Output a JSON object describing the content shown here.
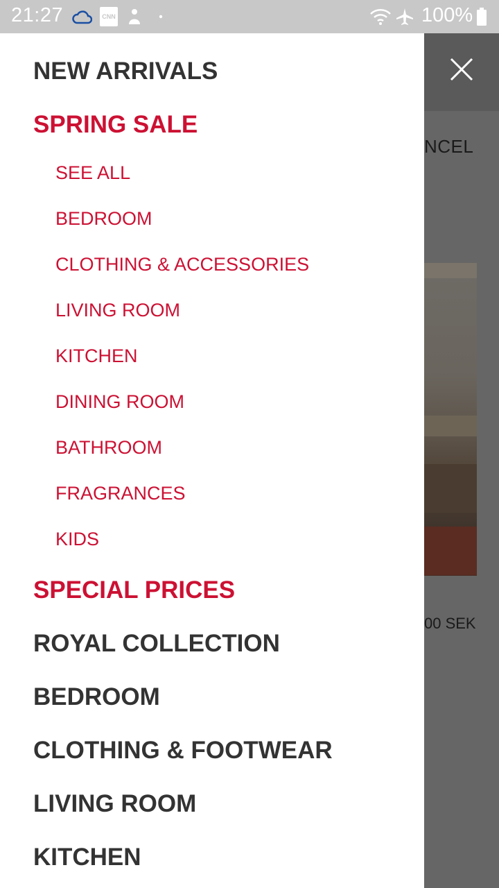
{
  "status_bar": {
    "time": "21:27",
    "battery": "100%",
    "icons": [
      "cloud-icon",
      "cnn-icon",
      "app-icon",
      "dot-icon",
      "wifi-icon",
      "airplane-icon",
      "battery-icon"
    ],
    "cnn_text": "CNN"
  },
  "drawer": {
    "top_items": [
      {
        "label": "NEW ARRIVALS"
      },
      {
        "label": "SPRING SALE"
      }
    ],
    "spring_sale_subitems": [
      {
        "label": "SEE ALL"
      },
      {
        "label": "BEDROOM"
      },
      {
        "label": "CLOTHING & ACCESSORIES"
      },
      {
        "label": "LIVING ROOM"
      },
      {
        "label": "KITCHEN"
      },
      {
        "label": "DINING ROOM"
      },
      {
        "label": "BATHROOM"
      },
      {
        "label": "FRAGRANCES"
      },
      {
        "label": "KIDS"
      }
    ],
    "bottom_items": [
      {
        "label": "SPECIAL PRICES"
      },
      {
        "label": "ROYAL COLLECTION"
      },
      {
        "label": "BEDROOM"
      },
      {
        "label": "CLOTHING & FOOTWEAR"
      },
      {
        "label": "LIVING ROOM"
      },
      {
        "label": "KITCHEN"
      }
    ]
  },
  "background": {
    "cancel_fragment": "NCEL",
    "price_fragment": "00 SEK"
  },
  "colors": {
    "accent_red": "#cc1133",
    "menu_text": "#333333",
    "overlay": "#666666",
    "status_bar": "#c8c8c8"
  }
}
